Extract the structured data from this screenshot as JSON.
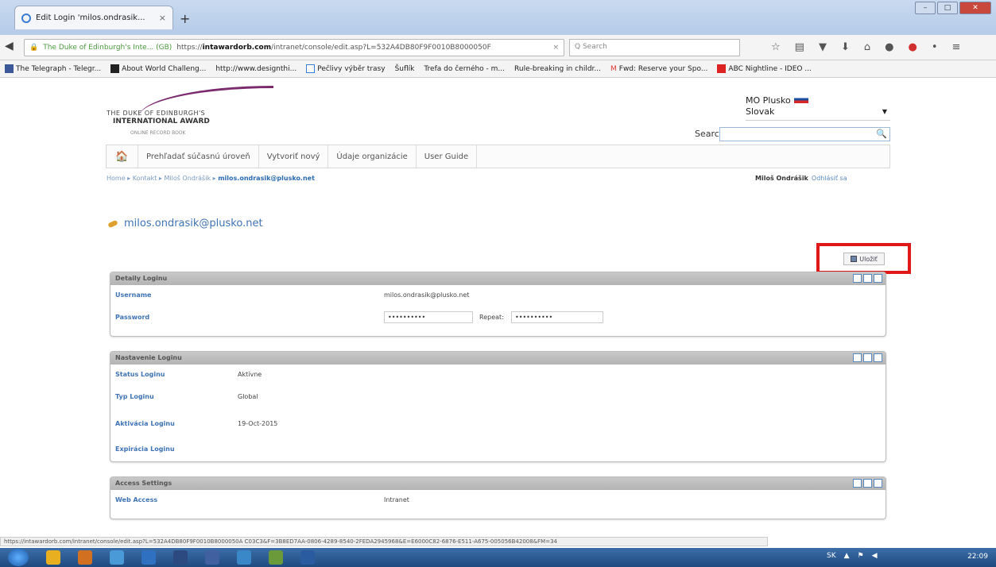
{
  "browser": {
    "tab_title": "Edit Login 'milos.ondrasik...",
    "tab_close": "×",
    "new_tab": "+",
    "url_site": "The Duke of Edinburgh's Inte... (GB)",
    "url_prefix": "https://",
    "url_host": "intawardorb.com",
    "url_path": "/intranet/console/edit.asp?L=532A4DB80F9F0010B8000050F",
    "url_clear": "×",
    "search_placeholder": "Q  Search",
    "bookmarks": [
      "The Telegraph - Telegr...",
      "About World Challeng...",
      "http://www.designthi...",
      "Pečlivy výběr trasy",
      "Šuflík",
      "Trefa do černého - m...",
      "Rule-breaking in childr...",
      "Fwd: Reserve your Spo...",
      "ABC Nightline - IDEO ..."
    ]
  },
  "header": {
    "logo_line1": "THE DUKE OF EDINBURGH'S",
    "logo_line2": "INTERNATIONAL AWARD",
    "logo_line3": "ONLINE RECORD BOOK",
    "user_label": "MO Plusko",
    "language": "Slovak",
    "search_label": "Search:"
  },
  "menu": {
    "items": [
      "Prehľadať súčasnú úroveň",
      "Vytvoriť nový",
      "Údaje organizácie",
      "User Guide"
    ]
  },
  "breadcrumb": {
    "items": [
      "Home",
      "Kontakt",
      "Miloš Ondrášik",
      "milos.ondrasik@plusko.net"
    ]
  },
  "user_area": {
    "name": "Miloš Ondrášik",
    "logout": "Odhlásiť sa"
  },
  "page_title": "milos.ondrasik@plusko.net",
  "save_label": "Uložiť",
  "panels": {
    "details": {
      "title": "Detaily Loginu",
      "username_label": "Username",
      "username_value": "milos.ondrasik@plusko.net",
      "password_label": "Password",
      "password_value": "••••••••••",
      "repeat_label": "Repeat:",
      "repeat_value": "••••••••••"
    },
    "settings": {
      "title": "Nastavenie Loginu",
      "status_label": "Status Loginu",
      "status_value": "Aktívne",
      "type_label": "Typ Loginu",
      "type_value": "Global",
      "activation_label": "Aktivácia Loginu",
      "activation_value": "19-Oct-2015",
      "expiry_label": "Expirácia Loginu",
      "expiry_value": ""
    },
    "access": {
      "title": "Access Settings",
      "web_label": "Web Access",
      "web_value": "Intranet"
    }
  },
  "statusbar": "https://intawardorb.com/intranet/console/edit.asp?L=532A4DB80F9F0010B8000050A C03C3&F=3B8ED7AA-0806-4289-8540-2FEDA2945968&E=E6000C82-6876-E511-A675-005056B42008&FM=34",
  "taskbar": {
    "clock": "22:09"
  }
}
